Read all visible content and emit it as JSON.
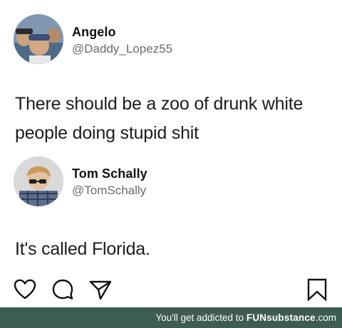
{
  "tweet1": {
    "name": "Angelo",
    "handle": "@Daddy_Lopez55",
    "text_line1": "There should be a zoo of drunk white",
    "text_line2": "people doing stupid shit"
  },
  "tweet2": {
    "name": "Tom Schally",
    "handle": "@TomSchally",
    "text": "It's called Florida."
  },
  "actions": {
    "icons": [
      "heart-icon",
      "comment-icon",
      "send-icon",
      "bookmark-icon"
    ]
  },
  "footer": {
    "prefix": "You'll get addicted to ",
    "brand": "FUNsubstance",
    "brand_tail": ".com",
    "background": "#3d5c54"
  }
}
